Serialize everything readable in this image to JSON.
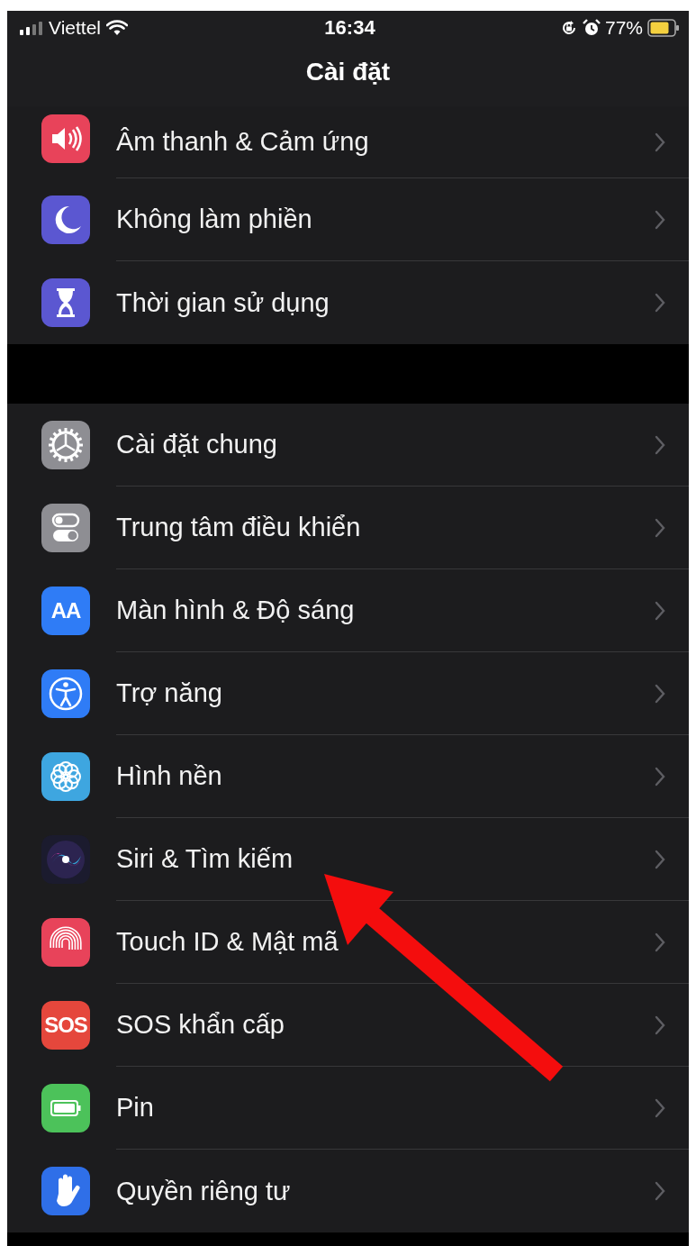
{
  "status_bar": {
    "carrier": "Viettel",
    "time": "16:34",
    "battery_percent": "77%",
    "low_power": true
  },
  "nav": {
    "title": "Cài đặt"
  },
  "groups": [
    {
      "rows": [
        {
          "label": "Âm thanh & Cảm ứng",
          "kind": "speaker",
          "color": "#e8435a",
          "cut_top": true
        },
        {
          "label": "Không làm phiền",
          "kind": "moon",
          "color": "#5b57d1"
        },
        {
          "label": "Thời gian sử dụng",
          "kind": "hourglass",
          "color": "#5b57d1"
        }
      ]
    },
    {
      "rows": [
        {
          "label": "Cài đặt chung",
          "kind": "gear",
          "color": "#8e8e93"
        },
        {
          "label": "Trung tâm điều khiển",
          "kind": "toggles",
          "color": "#8e8e93"
        },
        {
          "label": "Màn hình & Độ sáng",
          "kind": "text",
          "icon_text": "AA",
          "color": "#2f7cf6"
        },
        {
          "label": "Trợ năng",
          "kind": "accessibility",
          "color": "#2f7cf6"
        },
        {
          "label": "Hình nền",
          "kind": "flower",
          "color": "#3ea6e0"
        },
        {
          "label": "Siri & Tìm kiếm",
          "kind": "siri",
          "color": "#1b1b2e"
        },
        {
          "label": "Touch ID & Mật mã",
          "kind": "fingerprint",
          "color": "#e8435a"
        },
        {
          "label": "SOS khẩn cấp",
          "kind": "text",
          "icon_text": "SOS",
          "color": "#e5473c"
        },
        {
          "label": "Pin",
          "kind": "battery",
          "color": "#4cc25a"
        },
        {
          "label": "Quyền riêng tư",
          "kind": "hand",
          "color": "#2f6fe8"
        }
      ]
    }
  ],
  "annotation": {
    "kind": "arrow",
    "color": "#f40d0d"
  }
}
